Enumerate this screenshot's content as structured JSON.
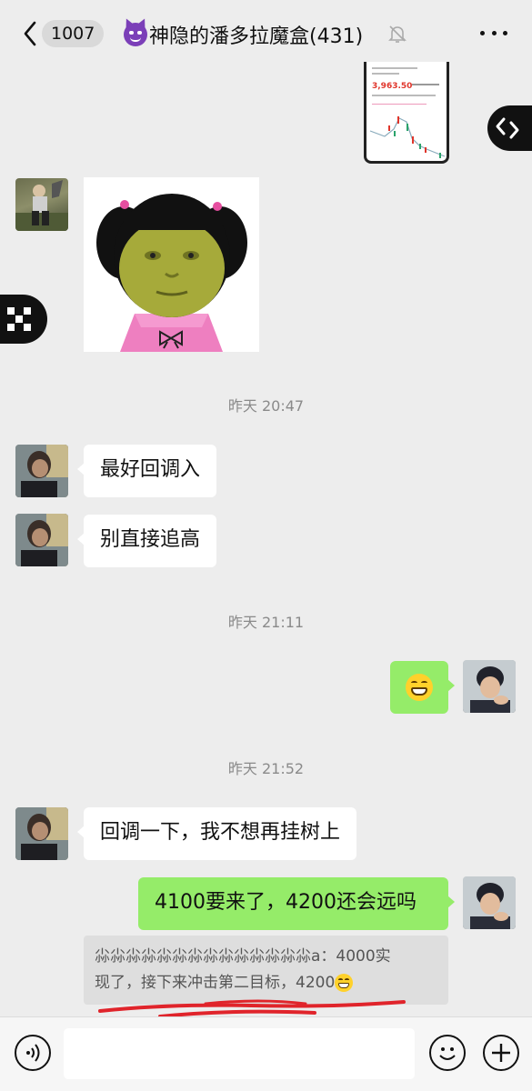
{
  "header": {
    "back_label": "<",
    "unread_count": "1007",
    "group_name": "神隐的潘多拉魔盒(431)",
    "title_emoji": "smiling-face-with-horns-icon",
    "mute_icon": "bell-slash-icon",
    "more_icon": "more-dots-icon"
  },
  "shared_image": {
    "price_text": "3,963.50",
    "icon": "stock-chart-screenshot"
  },
  "messages": [
    {
      "time": "昨天 20:47"
    },
    {
      "sender": "other",
      "text": "最好回调入"
    },
    {
      "sender": "other",
      "text": "别直接追高"
    },
    {
      "time": "昨天 21:11"
    },
    {
      "sender": "me",
      "emoji": "grinning-face-icon"
    },
    {
      "time": "昨天 21:52"
    },
    {
      "sender": "other",
      "text": "回调一下，我不想再挂树上"
    },
    {
      "sender": "me",
      "text": "4100要来了，4200还会远吗"
    }
  ],
  "quote": {
    "line1": "尛尛尛尛尛尛尛尛尛尛尛尛尛尛a：4000实",
    "line2": "现了，接下来冲击第二目标，4200"
  },
  "input": {
    "value": "",
    "placeholder": ""
  },
  "colors": {
    "background": "#ededed",
    "self_bubble": "#95ec69",
    "other_bubble": "#ffffff",
    "annotation": "#e0242b"
  }
}
